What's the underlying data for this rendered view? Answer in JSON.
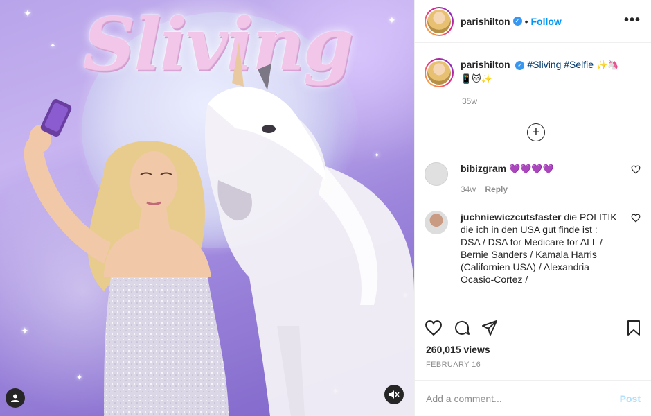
{
  "post": {
    "media_art_text": "Sliving",
    "media_alt": "Woman taking a selfie next to a white unicorn"
  },
  "header": {
    "username": "parishilton",
    "separator": "•",
    "follow_label": "Follow",
    "more_label": "•••"
  },
  "caption": {
    "username": "parishilton",
    "tags": "#Sliving #Selfie",
    "emoji_line1": "✨🦄",
    "emoji_line2": "📱🐱✨",
    "time": "35w"
  },
  "load_more_label": "+",
  "comments": [
    {
      "username": "bibizgram",
      "text": "💜💜💜💜",
      "time": "34w",
      "reply_label": "Reply"
    },
    {
      "username": "juchniewiczcutsfaster",
      "text": "die POLITIK die ich in den USA gut finde ist : DSA / DSA for Medicare for ALL / Bernie Sanders / Kamala Harris (Californien USA) / Alexandria Ocasio-Cortez /"
    }
  ],
  "actions": {
    "views": "260,015 views",
    "date": "FEBRUARY 16"
  },
  "add_comment": {
    "placeholder": "Add a comment...",
    "post_label": "Post"
  },
  "colors": {
    "link_blue": "#0095f6",
    "hashtag": "#00376b",
    "muted": "#8e8e8e",
    "post_disabled": "#b2dffc"
  }
}
